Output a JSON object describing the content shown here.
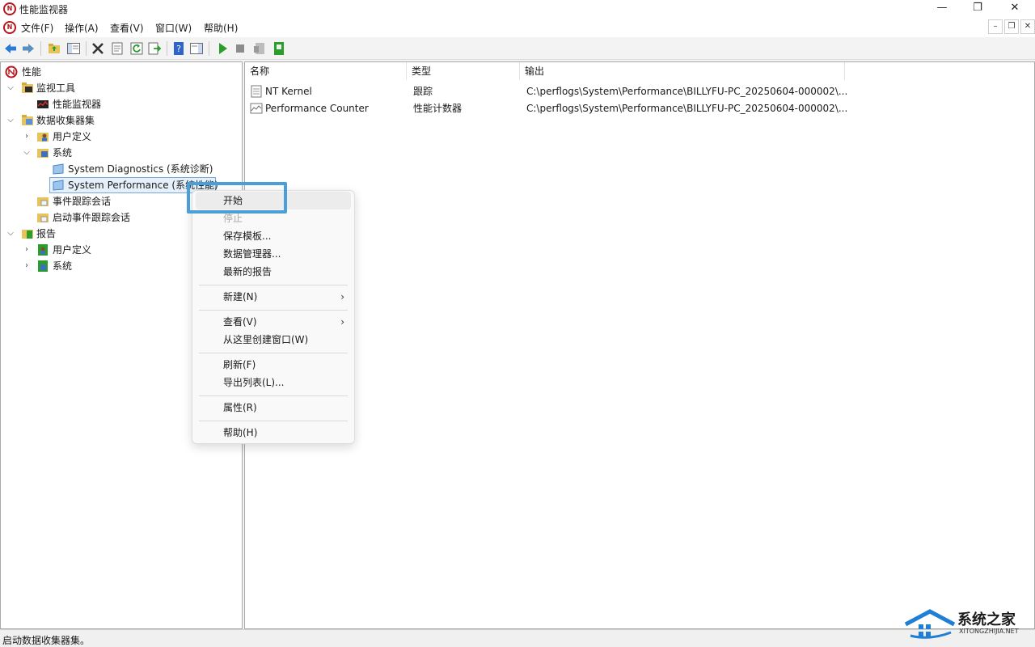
{
  "window": {
    "title": "性能监视器",
    "app_icon_text": "N",
    "controls": {
      "minimize": "—",
      "maximize": "❐",
      "close": "✕"
    }
  },
  "menubar": {
    "items": [
      "文件(F)",
      "操作(A)",
      "查看(V)",
      "窗口(W)",
      "帮助(H)"
    ],
    "mdi_controls": {
      "minimize": "–",
      "restore": "❐",
      "close": "✕"
    }
  },
  "tree": {
    "root": "性能",
    "monitor_tools": "监视工具",
    "perf_monitor": "性能监视器",
    "data_collector_sets": "数据收集器集",
    "user_defined": "用户定义",
    "system": "系统",
    "system_diagnostics": "System Diagnostics (系统诊断)",
    "system_performance": "System Performance (系统性能)",
    "event_trace_sessions": "事件跟踪会话",
    "startup_event_trace": "启动事件跟踪会话",
    "reports": "报告",
    "reports_user_defined": "用户定义",
    "reports_system": "系统"
  },
  "list": {
    "columns": [
      "名称",
      "类型",
      "输出"
    ],
    "rows": [
      {
        "name": "NT Kernel",
        "type": "跟踪",
        "output": "C:\\perflogs\\System\\Performance\\BILLYFU-PC_20250604-000002\\..."
      },
      {
        "name": "Performance Counter",
        "type": "性能计数器",
        "output": "C:\\perflogs\\System\\Performance\\BILLYFU-PC_20250604-000002\\..."
      }
    ]
  },
  "context_menu": {
    "start": "开始",
    "stop": "停止",
    "save_template": "保存模板...",
    "data_manager": "数据管理器...",
    "latest_report": "最新的报告",
    "new": "新建(N)",
    "view": "查看(V)",
    "new_window": "从这里创建窗口(W)",
    "refresh": "刷新(F)",
    "export_list": "导出列表(L)...",
    "properties": "属性(R)",
    "help": "帮助(H)"
  },
  "statusbar": {
    "text": "启动数据收集器集。"
  },
  "watermark": {
    "brand": "系统之家",
    "url": "XITONGZHIJIA.NET"
  },
  "colors": {
    "highlight_border": "#4a9fd8",
    "accent_green": "#2a9d2a"
  }
}
